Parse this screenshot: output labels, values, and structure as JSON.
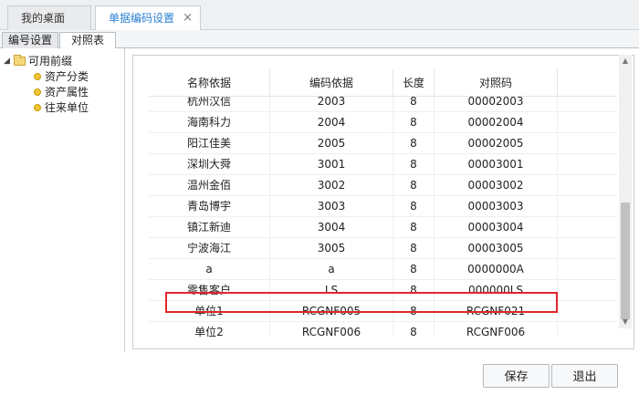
{
  "top_tabs": [
    {
      "label": "我的桌面"
    },
    {
      "label": "单据编码设置"
    }
  ],
  "close_glyph": "×",
  "sub_tabs": [
    {
      "label": "编号设置"
    },
    {
      "label": "对照表"
    }
  ],
  "tree": {
    "toggle": "◢",
    "root": "可用前缀",
    "children": [
      "资产分类",
      "资产属性",
      "往来单位"
    ]
  },
  "table": {
    "headers": [
      "名称依据",
      "编码依据",
      "长度",
      "对照码"
    ],
    "rows": [
      [
        "杭州汉信",
        "2003",
        "8",
        "00002003"
      ],
      [
        "海南科力",
        "2004",
        "8",
        "00002004"
      ],
      [
        "阳江佳美",
        "2005",
        "8",
        "00002005"
      ],
      [
        "深圳大舜",
        "3001",
        "8",
        "00003001"
      ],
      [
        "温州金佰",
        "3002",
        "8",
        "00003002"
      ],
      [
        "青岛博宇",
        "3003",
        "8",
        "00003003"
      ],
      [
        "镇江新迪",
        "3004",
        "8",
        "00003004"
      ],
      [
        "宁波海江",
        "3005",
        "8",
        "00003005"
      ],
      [
        "a",
        "a",
        "8",
        "0000000A"
      ],
      [
        "零售客户",
        "LS",
        "8",
        "000000LS"
      ],
      [
        "单位1",
        "RCGNF005",
        "8",
        "RCGNF021"
      ],
      [
        "单位2",
        "RCGNF006",
        "8",
        "RCGNF006"
      ]
    ],
    "highlight_color": "#e0262b"
  },
  "scroll": {
    "up": "▲",
    "down": "▼"
  },
  "buttons": {
    "save": "保存",
    "exit": "退出"
  },
  "colors": {
    "accent": "#2a7fd4",
    "highlight": "#e0262b"
  }
}
